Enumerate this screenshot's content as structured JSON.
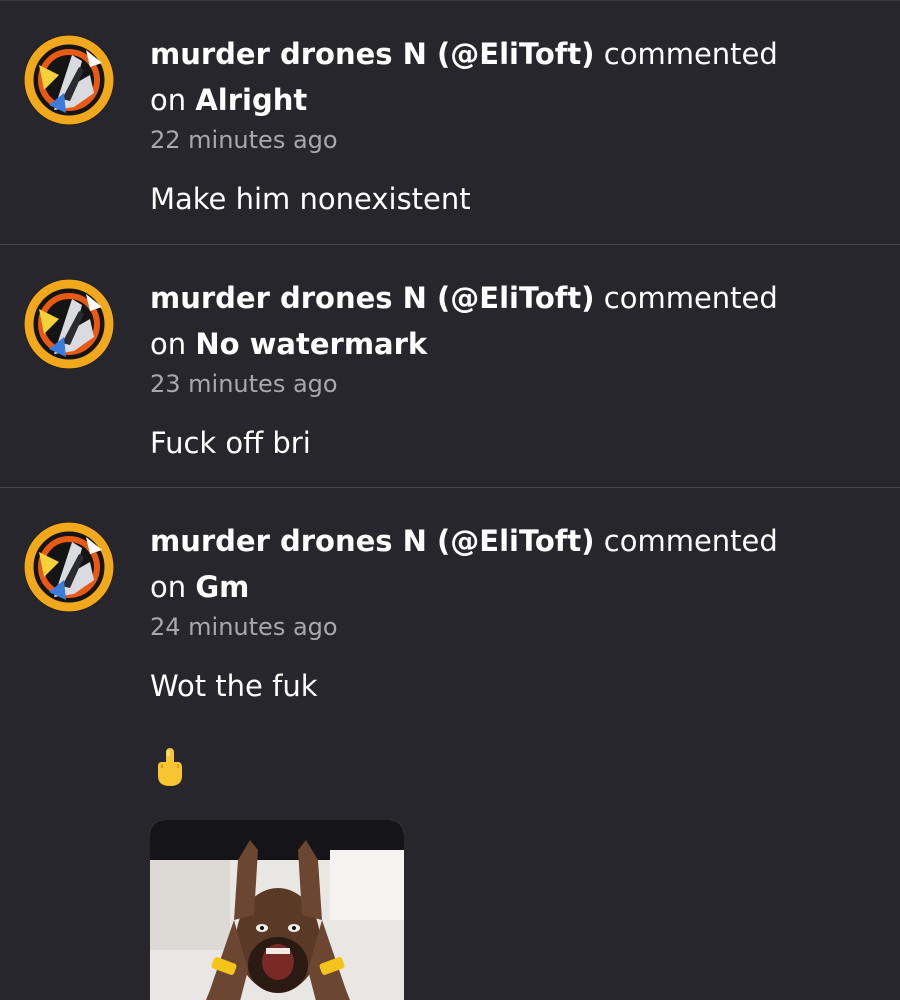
{
  "notifications": [
    {
      "user_display": "murder drones N (@EliToft)",
      "action": "commented",
      "on_word": "on",
      "post_title": "Alright",
      "time_ago": "22 minutes ago",
      "comment_text": "Make him nonexistent"
    },
    {
      "user_display": "murder drones N (@EliToft)",
      "action": "commented",
      "on_word": "on",
      "post_title": "No watermark",
      "time_ago": "23 minutes ago",
      "comment_text": "Fuck off bri"
    },
    {
      "user_display": "murder drones N (@EliToft)",
      "action": "commented",
      "on_word": "on",
      "post_title": "Gm",
      "time_ago": "24 minutes ago",
      "comment_text": "Wot the fuk",
      "emoji": "middle-finger-emoji",
      "image": "reaction-gif"
    }
  ],
  "colors": {
    "background": "#28262d",
    "divider": "#45434b",
    "text_primary": "#ffffff",
    "text_secondary": "#a9a7ae"
  }
}
